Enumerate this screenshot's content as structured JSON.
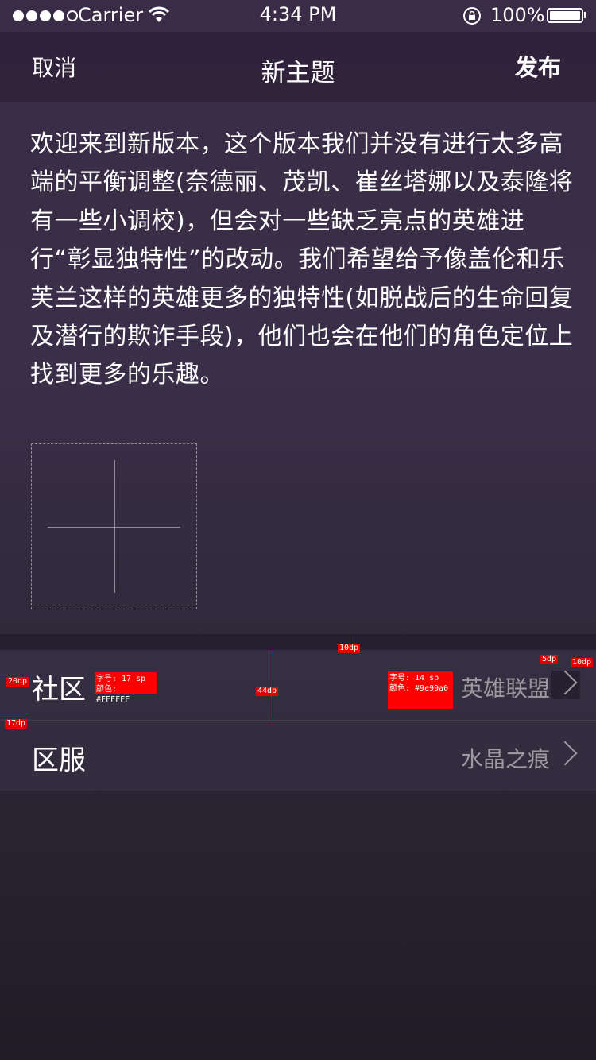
{
  "status_bar": {
    "carrier": "Carrier",
    "time": "4:34 PM",
    "battery_percent": "100%",
    "signal_bars": 4,
    "signal_total": 5,
    "battery_level": 1.0
  },
  "nav": {
    "cancel_label": "取消",
    "title": "新主题",
    "publish_label": "发布"
  },
  "post": {
    "body": "欢迎来到新版本，这个版本我们并没有进行太多高端的平衡调整(奈德丽、茂凯、崔丝塔娜以及泰隆将有一些小调校)，但会对一些缺乏亮点的英雄进行“彰显独特性”的改动。我们希望给予像盖伦和乐芙兰这样的英雄更多的独特性(如脱战后的生命回复及潜行的欺诈手段)，他们也会在他们的角色定位上找到更多的乐趣。"
  },
  "settings": {
    "rows": [
      {
        "label": "社区",
        "value": "英雄联盟"
      },
      {
        "label": "区服",
        "value": "水晶之痕"
      }
    ]
  },
  "annotations": {
    "label_spec_size": "字号: 17 sp",
    "label_spec_color": "颜色: #FFFFFF",
    "value_spec_size": "字号: 14 sp",
    "value_spec_color": "颜色: #9e99a0",
    "gap_top": "10dp",
    "row_height": "44dp",
    "left_padding_text": "20dp",
    "left_padding_bottom": "17dp",
    "chevron_gap": "5dp",
    "right_padding": "10dp"
  },
  "colors": {
    "label_text": "#FFFFFF",
    "value_text": "#9e99a0",
    "annotation": "#ff0000"
  }
}
